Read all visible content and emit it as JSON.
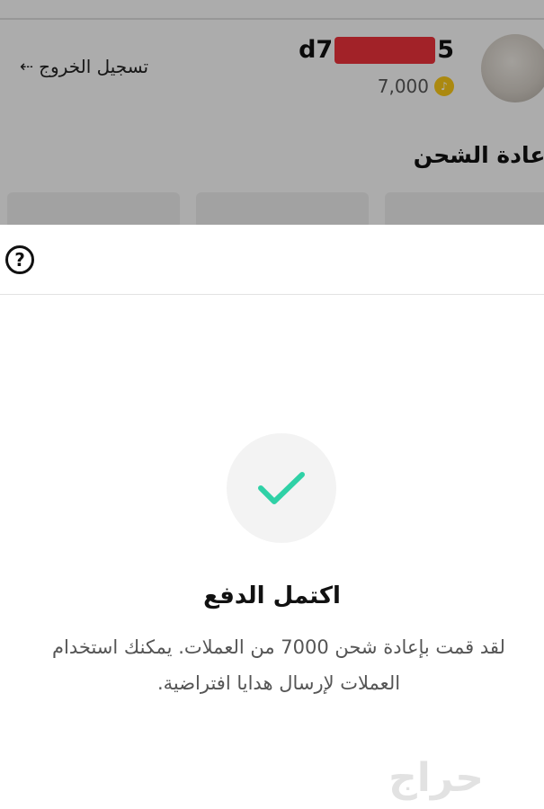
{
  "profile": {
    "logout_label": "تسجيل الخروج",
    "username_prefix": "d7",
    "username_suffix": "5",
    "coin_balance": "7,000"
  },
  "recharge": {
    "title": "إعادة الشحن"
  },
  "result": {
    "title": "اكتمل الدفع",
    "message": "لقد قمت بإعادة شحن 7000 من العملات. يمكنك استخدام العملات لإرسال هدايا افتراضية."
  },
  "watermark": "حراج",
  "colors": {
    "accent_check": "#2fd1a6",
    "coin": "#f5c518",
    "redaction": "#e8323a"
  },
  "icons": {
    "help": "help-question-icon",
    "success": "checkmark-icon",
    "logout": "logout-arrow-icon"
  }
}
